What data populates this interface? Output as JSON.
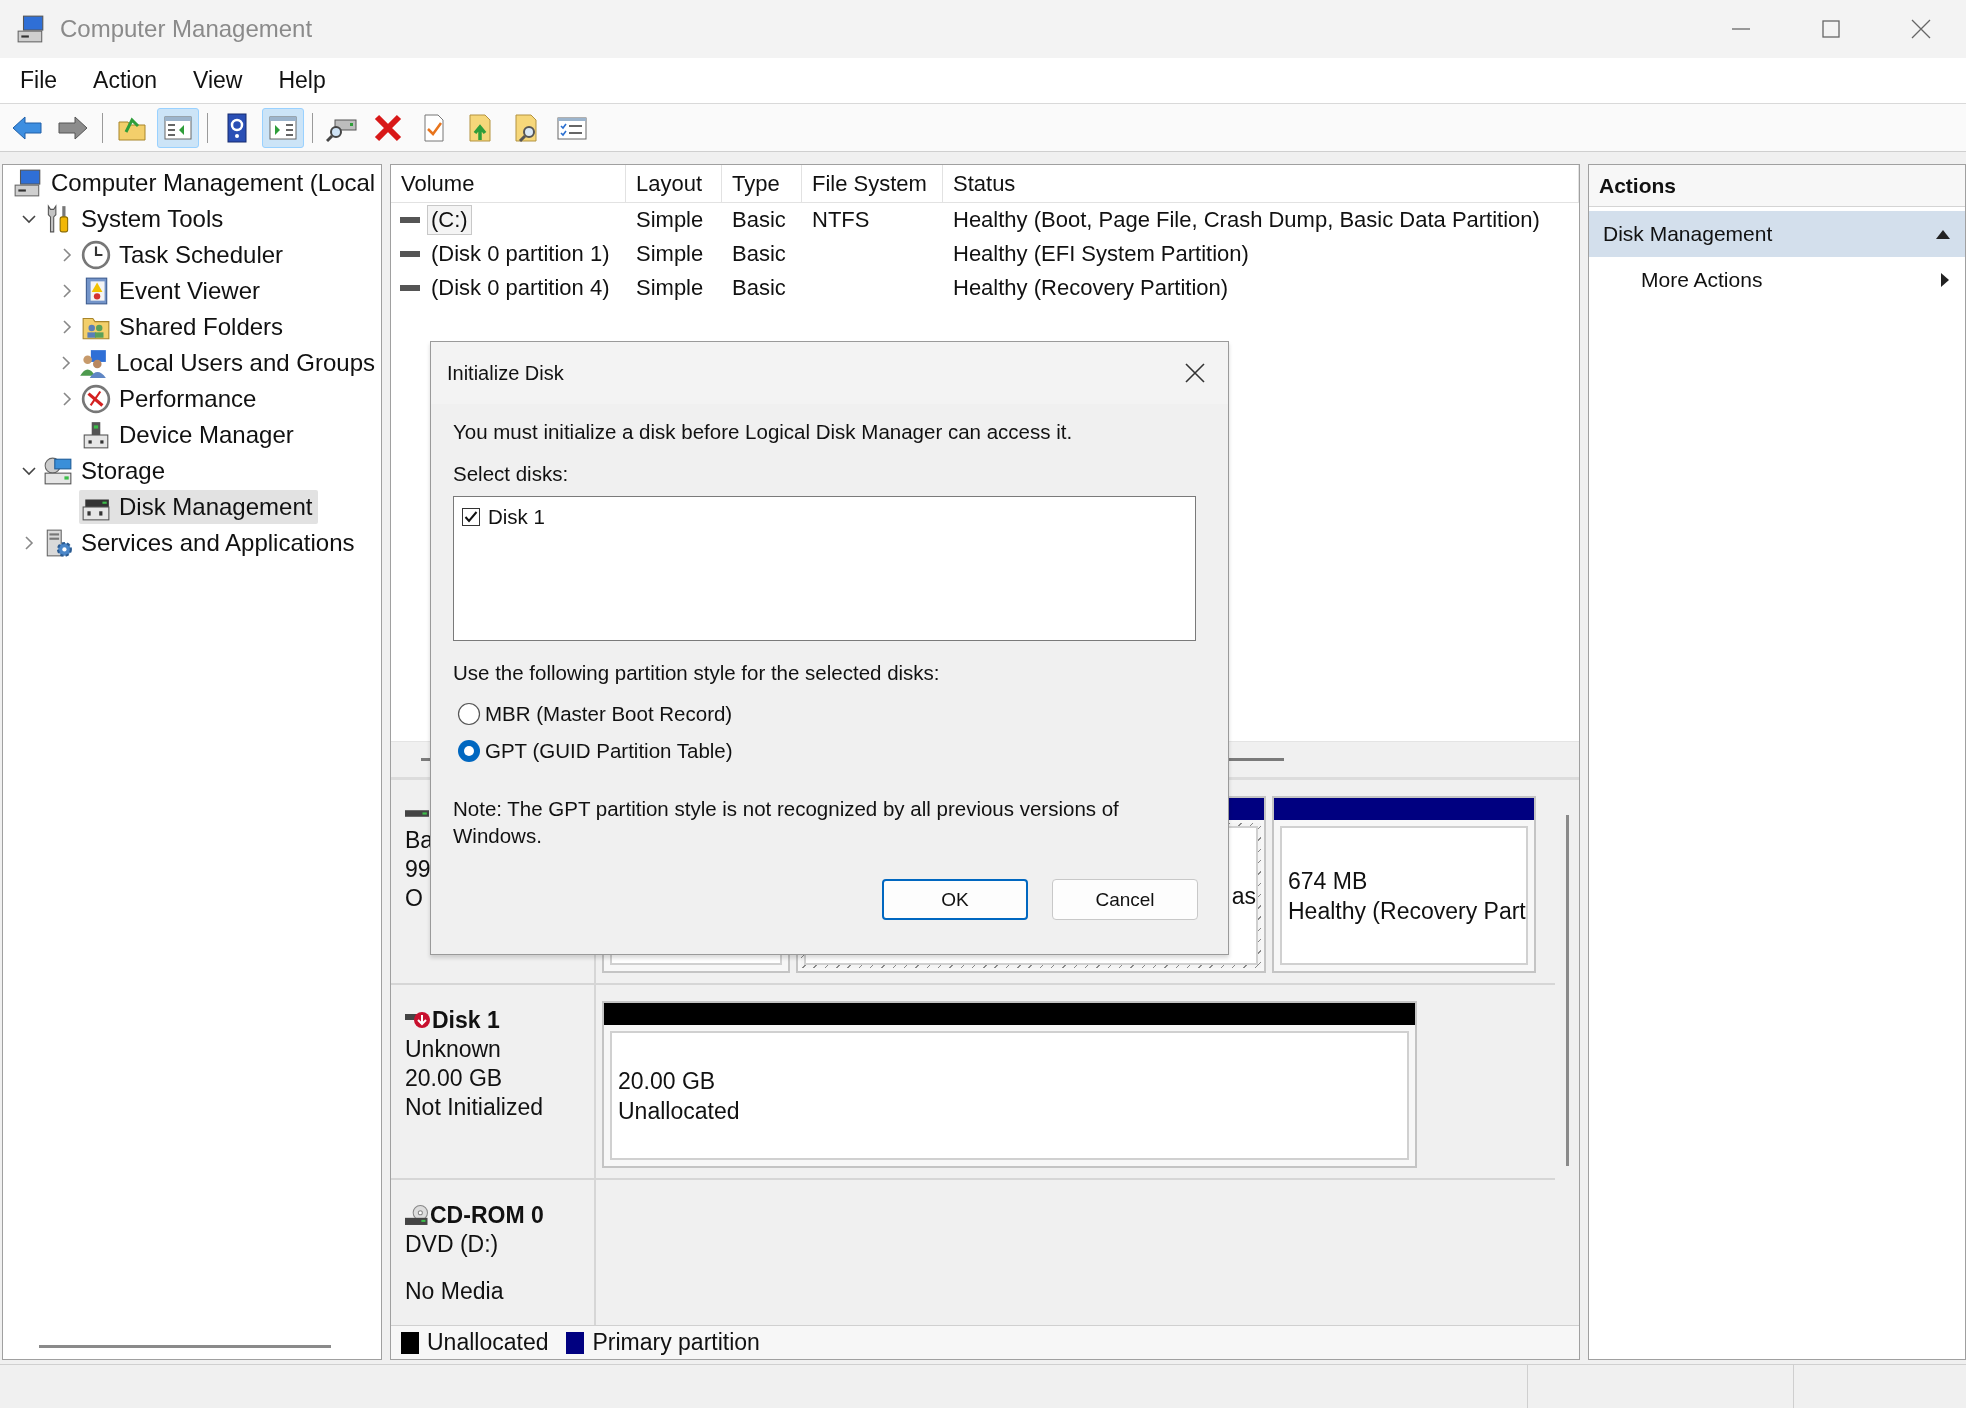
{
  "window": {
    "title": "Computer Management"
  },
  "menu": [
    "File",
    "Action",
    "View",
    "Help"
  ],
  "toolbar": [
    [
      {
        "kind": "back",
        "pressed": false
      },
      {
        "kind": "forward",
        "pressed": false
      }
    ],
    [
      {
        "kind": "up",
        "pressed": false
      },
      {
        "kind": "tree",
        "pressed": true
      }
    ],
    [
      {
        "kind": "help",
        "pressed": false
      },
      {
        "kind": "pane",
        "pressed": true
      }
    ],
    [
      {
        "kind": "connect",
        "pressed": false
      },
      {
        "kind": "delete",
        "pressed": false
      },
      {
        "kind": "check",
        "pressed": false
      },
      {
        "kind": "export",
        "pressed": false
      },
      {
        "kind": "find",
        "pressed": false
      },
      {
        "kind": "properties",
        "pressed": false
      }
    ]
  ],
  "tree": [
    {
      "label": "Computer Management (Local",
      "kind": "computer",
      "selected": false,
      "children": [
        {
          "label": "System Tools",
          "kind": "tools",
          "expanded": true,
          "selected": false,
          "children": [
            {
              "label": "Task Scheduler",
              "kind": "clock",
              "expanded": false,
              "selected": false
            },
            {
              "label": "Event Viewer",
              "kind": "log",
              "expanded": false,
              "selected": false
            },
            {
              "label": "Shared Folders",
              "kind": "shared",
              "expanded": false,
              "selected": false
            },
            {
              "label": "Local Users and Groups",
              "kind": "users",
              "expanded": false,
              "selected": false
            },
            {
              "label": "Performance",
              "kind": "gauge",
              "expanded": false,
              "selected": false
            },
            {
              "label": "Device Manager",
              "kind": "device",
              "selected": false
            }
          ]
        },
        {
          "label": "Storage",
          "kind": "storage",
          "expanded": true,
          "selected": false,
          "children": [
            {
              "label": "Disk Management",
              "kind": "disk",
              "selected": true
            }
          ]
        },
        {
          "label": "Services and Applications",
          "kind": "services",
          "expanded": false,
          "selected": false
        }
      ]
    }
  ],
  "volumes": {
    "columns": [
      "Volume",
      "Layout",
      "Type",
      "File System",
      "Status"
    ],
    "rows": [
      {
        "selected": true,
        "cells": [
          "(C:)",
          "Simple",
          "Basic",
          "NTFS",
          "Healthy (Boot, Page File, Crash Dump, Basic Data Partition)"
        ]
      },
      {
        "selected": false,
        "cells": [
          "(Disk 0 partition 1)",
          "Simple",
          "Basic",
          "",
          "Healthy (EFI System Partition)"
        ]
      },
      {
        "selected": false,
        "cells": [
          "(Disk 0 partition 4)",
          "Simple",
          "Basic",
          "",
          "Healthy (Recovery Partition)"
        ]
      }
    ]
  },
  "disks": [
    {
      "kind": "basic",
      "lines": [
        "Ba",
        "99",
        "O"
      ],
      "partitions": [
        {
          "kind": "primary",
          "selected": false
        },
        {
          "kind": "primary",
          "selected": true,
          "lines": [
            "as"
          ]
        },
        {
          "kind": "primary",
          "selected": false,
          "lines": [
            "674 MB",
            "Healthy (Recovery Part"
          ]
        }
      ]
    },
    {
      "kind": "unknown",
      "title": "Disk 1",
      "lines": [
        "Unknown",
        "20.00 GB",
        "Not Initialized"
      ],
      "partitions": [
        {
          "kind": "unallocated",
          "selected": false,
          "lines": [
            "20.00 GB",
            "Unallocated"
          ]
        }
      ]
    },
    {
      "kind": "cdrom",
      "title": "CD-ROM 0",
      "lines": [
        "DVD (D:)",
        "No Media"
      ]
    }
  ],
  "legend": [
    {
      "label": "Unallocated",
      "color": "#000000"
    },
    {
      "label": "Primary partition",
      "color": "#000080"
    }
  ],
  "actions": {
    "title": "Actions",
    "items": [
      {
        "kind": "section",
        "label": "Disk Management"
      },
      {
        "kind": "submenu",
        "label": "More Actions"
      }
    ]
  },
  "dialog": {
    "title": "Initialize Disk",
    "message": "You must initialize a disk before Logical Disk Manager can access it.",
    "list_label": "Select disks:",
    "disks": [
      {
        "label": "Disk 1",
        "checked": true
      }
    ],
    "style_label": "Use the following partition style for the selected disks:",
    "options": [
      {
        "label": "MBR (Master Boot Record)",
        "selected": false
      },
      {
        "label": "GPT (GUID Partition Table)",
        "selected": true
      }
    ],
    "note": "Note: The GPT partition style is not recognized by all previous versions of Windows.",
    "buttons": [
      {
        "label": "OK",
        "default": true
      },
      {
        "label": "Cancel",
        "default": false
      }
    ]
  }
}
